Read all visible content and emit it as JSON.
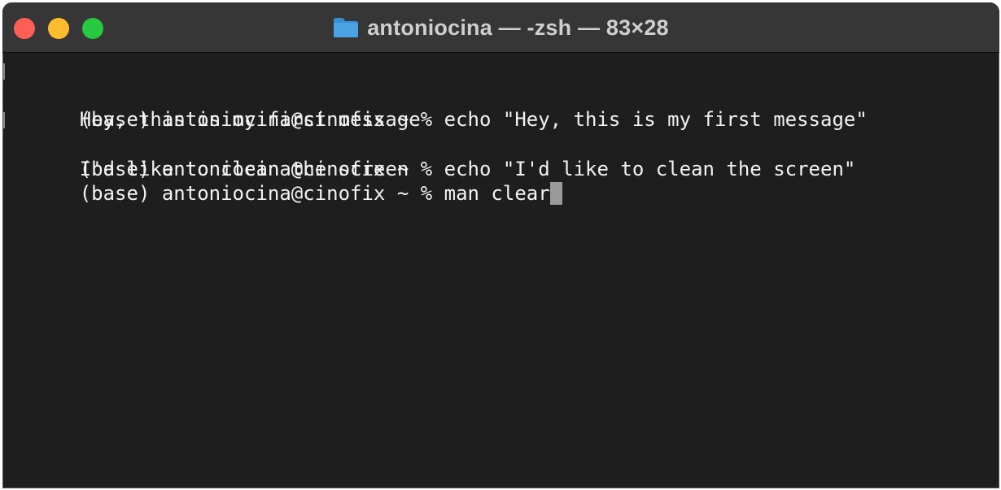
{
  "window": {
    "title": "antoniocina — -zsh — 83×28",
    "traffic_lights": {
      "close_color": "#fe5f57",
      "minimize_color": "#febc2e",
      "zoom_color": "#28c840"
    },
    "folder_icon": "folder-icon",
    "folder_icon_color": "#4ba3e3"
  },
  "terminal": {
    "background": "#1e1e1e",
    "foreground": "#f2f2f2",
    "lines": [
      "(base) antoniocina@cinofix ~ % echo \"Hey, this is my first message\"",
      "Hey, this is my first message",
      "(base) antoniocina@cinofix ~ % echo \"I'd like to clean the screen\"",
      "I'd like to clean the screen",
      "(base) antoniocina@cinofix ~ % man clear"
    ]
  }
}
